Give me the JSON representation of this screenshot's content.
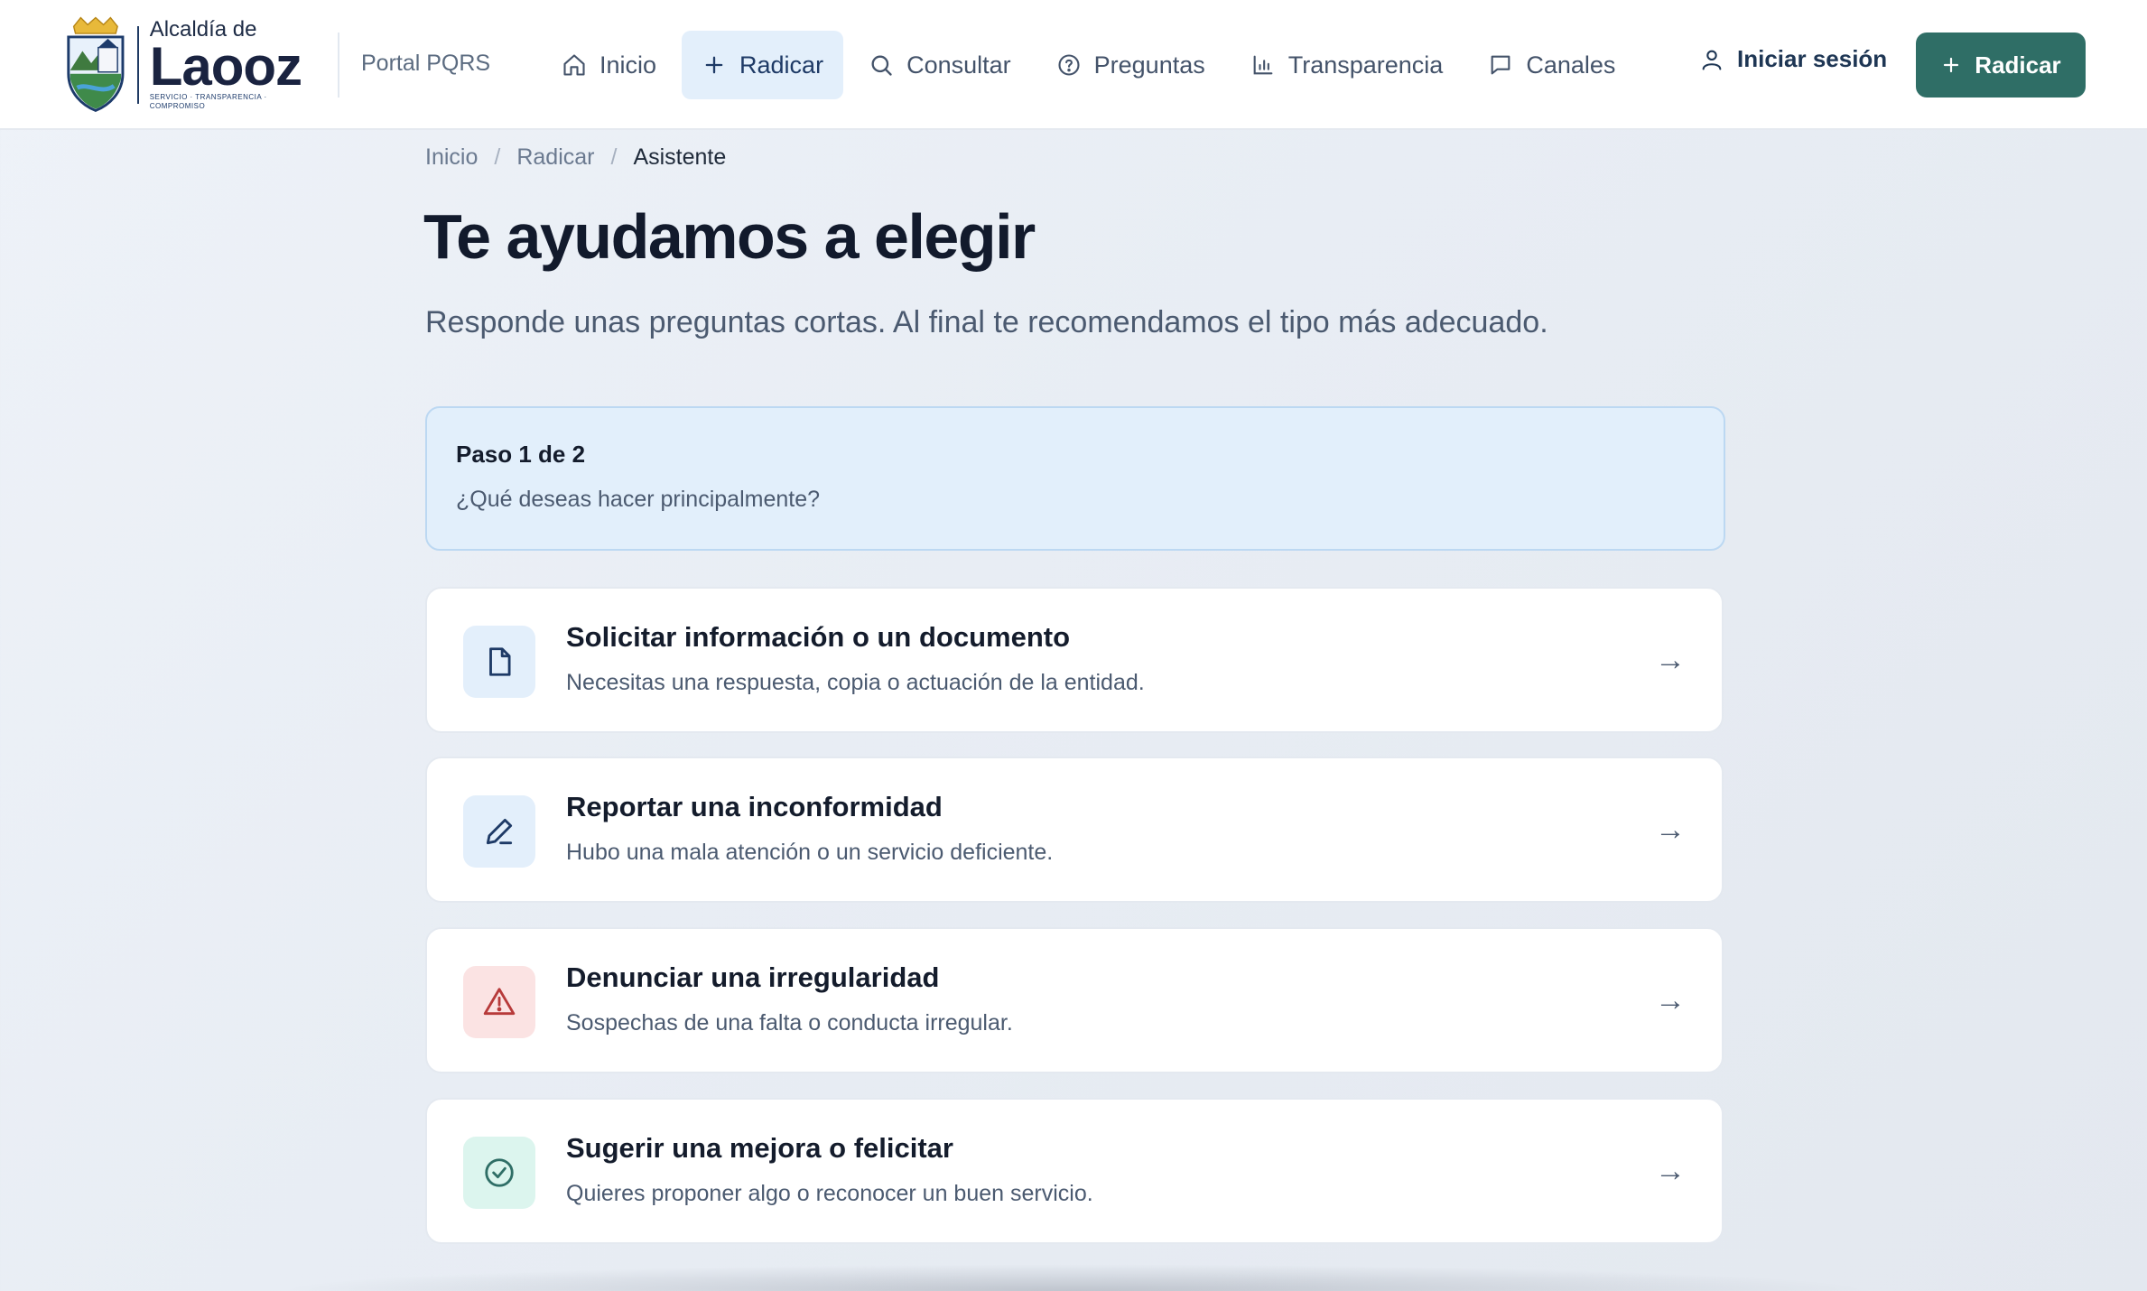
{
  "header": {
    "logo": {
      "small": "Alcaldía de",
      "big": "Laooz",
      "tagline": "SERVICIO · TRANSPARENCIA · COMPROMISO"
    },
    "portal_label": "Portal PQRS",
    "nav": [
      {
        "label": "Inicio",
        "icon": "home-icon"
      },
      {
        "label": "Radicar",
        "icon": "plus-icon",
        "active": true
      },
      {
        "label": "Consultar",
        "icon": "search-icon"
      },
      {
        "label": "Preguntas",
        "icon": "help-circle-icon"
      },
      {
        "label": "Transparencia",
        "icon": "bar-chart-icon"
      },
      {
        "label": "Canales",
        "icon": "chat-icon"
      }
    ],
    "login_label": "Iniciar sesión",
    "cta_label": "Radicar"
  },
  "breadcrumb": [
    "Inicio",
    "Radicar",
    "Asistente"
  ],
  "page": {
    "title": "Te ayudamos a elegir",
    "subtitle": "Responde unas preguntas cortas. Al final te recomendamos el tipo más adecuado."
  },
  "step": {
    "label": "Paso 1 de 2",
    "question": "¿Qué deseas hacer principalmente?"
  },
  "options": [
    {
      "title": "Solicitar información o un documento",
      "desc": "Necesitas una respuesta, copia o actuación de la entidad.",
      "icon": "document-icon",
      "color": "#e3effb"
    },
    {
      "title": "Reportar una inconformidad",
      "desc": "Hubo una mala atención o un servicio deficiente.",
      "icon": "pencil-icon",
      "color": "#e3effb"
    },
    {
      "title": "Denunciar una irregularidad",
      "desc": "Sospechas de una falta o conducta irregular.",
      "icon": "warning-icon",
      "color": "#fbe3e3"
    },
    {
      "title": "Sugerir una mejora o felicitar",
      "desc": "Quieres proponer algo o reconocer un buen servicio.",
      "icon": "check-circle-icon",
      "color": "#dcf5ee"
    }
  ],
  "arrow": "→",
  "colors": {
    "primary": "#2f6e66",
    "accent_light": "#e3effb",
    "danger": "#b73a3a",
    "success": "#2f6e66"
  }
}
